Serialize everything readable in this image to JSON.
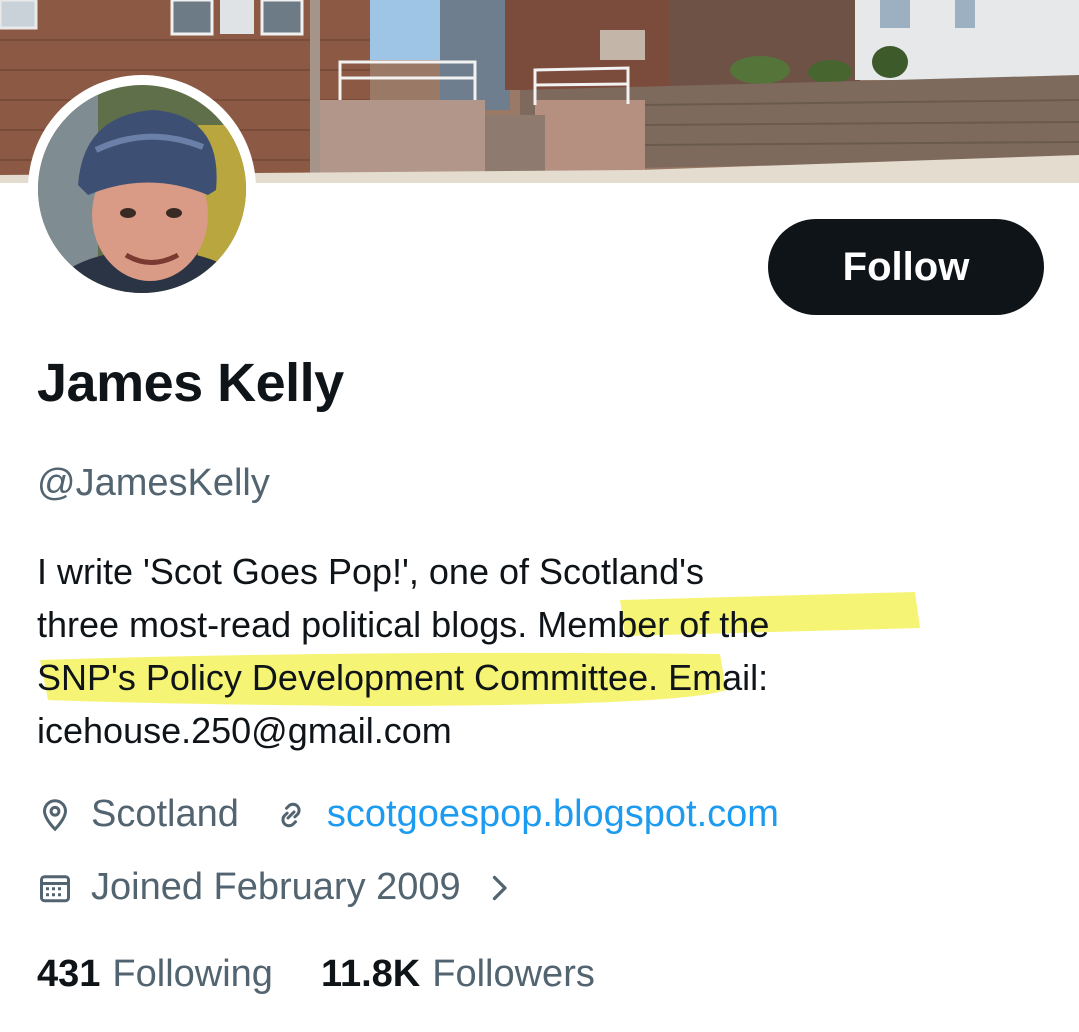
{
  "profile": {
    "name": "James Kelly",
    "handle": "@JamesKelly",
    "bio_plain_1": "I write 'Scot Goes Pop!', one of Scotland's\nthree most-read political blogs.  ",
    "bio_highlight": "Member of the\nSNP's Policy Development Committee",
    "bio_plain_2": ".  Email:\nicehouse.250@gmail.com",
    "location": "Scotland",
    "website": "scotgoespop.blogspot.com",
    "joined": "Joined February 2009"
  },
  "actions": {
    "follow_label": "Follow"
  },
  "stats": {
    "following_count": "431",
    "following_label": "Following",
    "followers_count": "11.8K",
    "followers_label": "Followers"
  },
  "icons": {
    "location": "location-pin-icon",
    "website": "link-icon",
    "joined": "calendar-icon",
    "joined_more": "chevron-right-icon"
  },
  "colors": {
    "follow_button_bg": "#0f1419",
    "link": "#1d9bf0",
    "secondary_text": "#536471",
    "highlight": "#f3f046"
  }
}
